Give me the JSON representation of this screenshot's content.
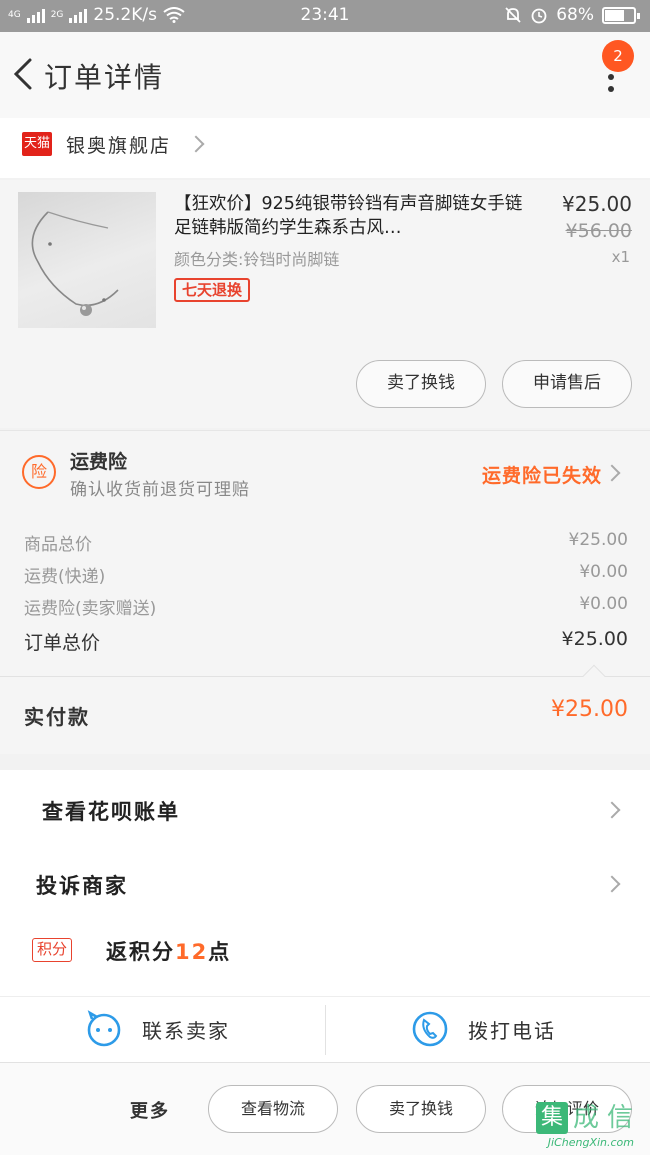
{
  "status_bar": {
    "network": "4G",
    "network2": "2G",
    "speed": "25.2K/s",
    "time": "23:41",
    "battery": "68%",
    "battery_level": 0.68
  },
  "header": {
    "title": "订单详情",
    "badge": "2"
  },
  "shop": {
    "badge": "天猫",
    "name": "银奥旗舰店"
  },
  "product": {
    "title": "【狂欢价】925纯银带铃铛有声音脚链女手链足链韩版简约学生森系古风…",
    "spec": "颜色分类:铃铛时尚脚链",
    "tag": "七天退换",
    "price": "¥25.00",
    "original_price": "¥56.00",
    "quantity": "x1",
    "buttons": [
      "卖了换钱",
      "申请售后"
    ]
  },
  "insurance": {
    "icon_label": "险",
    "title": "运费险",
    "desc": "确认收货前退货可理赔",
    "status": "运费险已失效"
  },
  "costs": [
    {
      "label": "商品总价",
      "value": "¥25.00"
    },
    {
      "label": "运费(快递)",
      "value": "¥0.00"
    },
    {
      "label": "运费险(卖家赠送)",
      "value": "¥0.00"
    }
  ],
  "order_total": {
    "label": "订单总价",
    "value": "¥25.00"
  },
  "paid": {
    "label": "实付款",
    "value": "¥25.00"
  },
  "links": {
    "huabei": "查看花呗账单",
    "complain": "投诉商家",
    "points_tag": "积分",
    "points_prefix": "返积分",
    "points_value": "12",
    "points_suffix": "点"
  },
  "contact": {
    "seller": "联系卖家",
    "call": "拨打电话"
  },
  "bottom": {
    "more": "更多",
    "buttons": [
      "查看物流",
      "卖了换钱",
      "追加评价"
    ]
  },
  "watermark": {
    "text": "集成信",
    "sub": "JiChengXin.com"
  },
  "colors": {
    "accent": "#ff6a2a",
    "tmall_red": "#e2231a",
    "status_bar": "#9a9a9a"
  }
}
